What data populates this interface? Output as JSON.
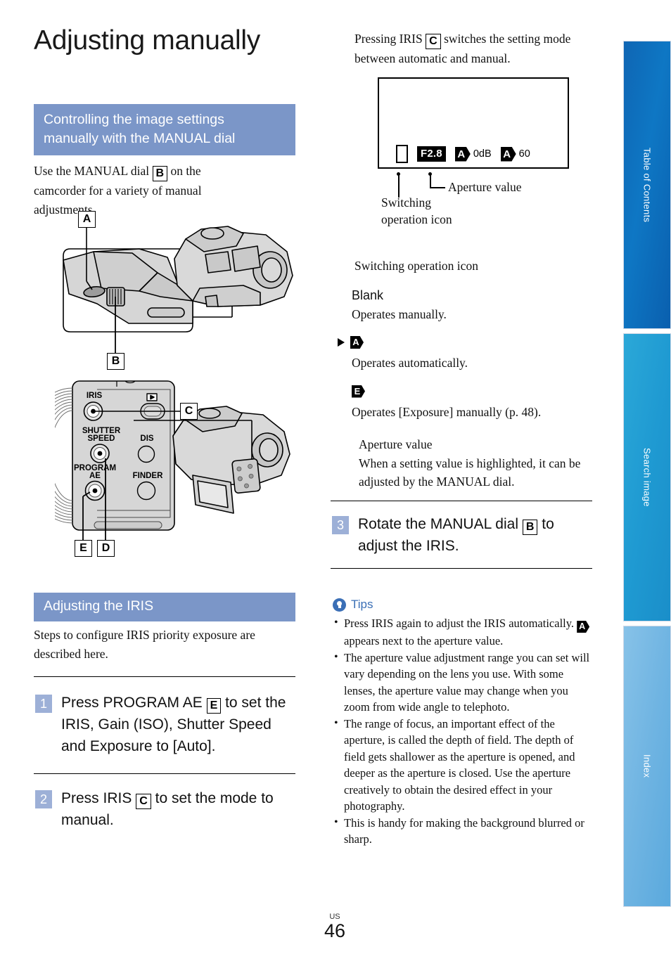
{
  "page": {
    "title": "Adjusting manually",
    "footer_locale": "US",
    "footer_number": "46",
    "accent_header": "#7b96c8",
    "accent_step": "#9db0d7",
    "accent_tips": "#3b6fb6"
  },
  "sidebar": {
    "tabs": [
      {
        "label": "Table of Contents",
        "color": "#0e77c4"
      },
      {
        "label": "Search image",
        "color": "#1f9ad2"
      },
      {
        "label": "Index",
        "color": "#6fb4e2"
      }
    ]
  },
  "left": {
    "section1_title_line1": "Controlling the image settings",
    "section1_title_line2": "manually with the MANUAL dial",
    "intro": {
      "pre": "Use the MANUAL dial",
      "key": "B",
      "post": "on the camcorder for a variety of manual adjustments."
    },
    "diagram1": {
      "callouts": [
        "A",
        "B"
      ],
      "caption": "camcorder-top-controls"
    },
    "diagram2": {
      "callouts": [
        "C",
        "E",
        "D"
      ],
      "button_labels": [
        "IRIS",
        "SHUTTER SPEED",
        "DIS",
        "PROGRAM AE",
        "FINDER"
      ]
    },
    "section2_title": "Adjusting the IRIS",
    "section2_intro": "Steps to configure IRIS priority exposure are described here.",
    "steps": [
      {
        "num": "1",
        "pre": "Press PROGRAM AE",
        "key": "E",
        "post": "to set the IRIS, Gain (ISO), Shutter Speed and Exposure to [Auto]."
      },
      {
        "num": "2",
        "pre": "Press IRIS",
        "key": "C",
        "post": "to set the mode to manual."
      }
    ]
  },
  "right": {
    "intro": {
      "pre": "Pressing IRIS",
      "key": "C",
      "post": "switches the setting mode between automatic and manual."
    },
    "lcd": {
      "blank_icon": "blank-box",
      "aperture": "F2.8",
      "gain_badge": "A",
      "gain_value": "0dB",
      "shutter_badge": "A",
      "shutter_value": "60"
    },
    "leader_labels": {
      "aperture": "Aperture value",
      "switching_line1": "Switching",
      "switching_line2": "operation icon"
    },
    "switch_icon_heading": "Switching operation icon",
    "switch_icon_items": [
      {
        "badge": "Blank",
        "badge_type": "text",
        "desc": "Operates manually.",
        "arrow": false
      },
      {
        "badge": "A",
        "badge_type": "pentagon",
        "desc": "Operates automatically.",
        "arrow": true
      },
      {
        "badge": "E",
        "badge_type": "pentagon",
        "desc": "Operates [Exposure] manually (p. 48).",
        "arrow": false
      }
    ],
    "aperture_block": {
      "heading": "Aperture value",
      "body": "When a setting value is highlighted, it can be adjusted by the MANUAL dial."
    },
    "step3": {
      "num": "3",
      "pre": "Rotate the MANUAL dial",
      "key": "B",
      "post": "to adjust the IRIS."
    },
    "tips_label": "Tips",
    "tips": [
      {
        "part1": "Press IRIS again to adjust the IRIS automatically.",
        "badge": "A",
        "part2": "appears next to the aperture value."
      },
      {
        "part1": "The aperture value adjustment range you can set will vary depending on the lens you use. With some lenses, the aperture value may change when you zoom from wide angle to telephoto.",
        "badge": "",
        "part2": ""
      },
      {
        "part1": "The range of focus, an important effect of the aperture, is called the depth of field. The depth of field gets shallower as the aperture is opened, and deeper as the aperture is closed. Use the aperture creatively to obtain the desired effect in your photography.",
        "badge": "",
        "part2": ""
      },
      {
        "part1": "This is handy for making the background blurred or sharp.",
        "badge": "",
        "part2": ""
      }
    ]
  }
}
